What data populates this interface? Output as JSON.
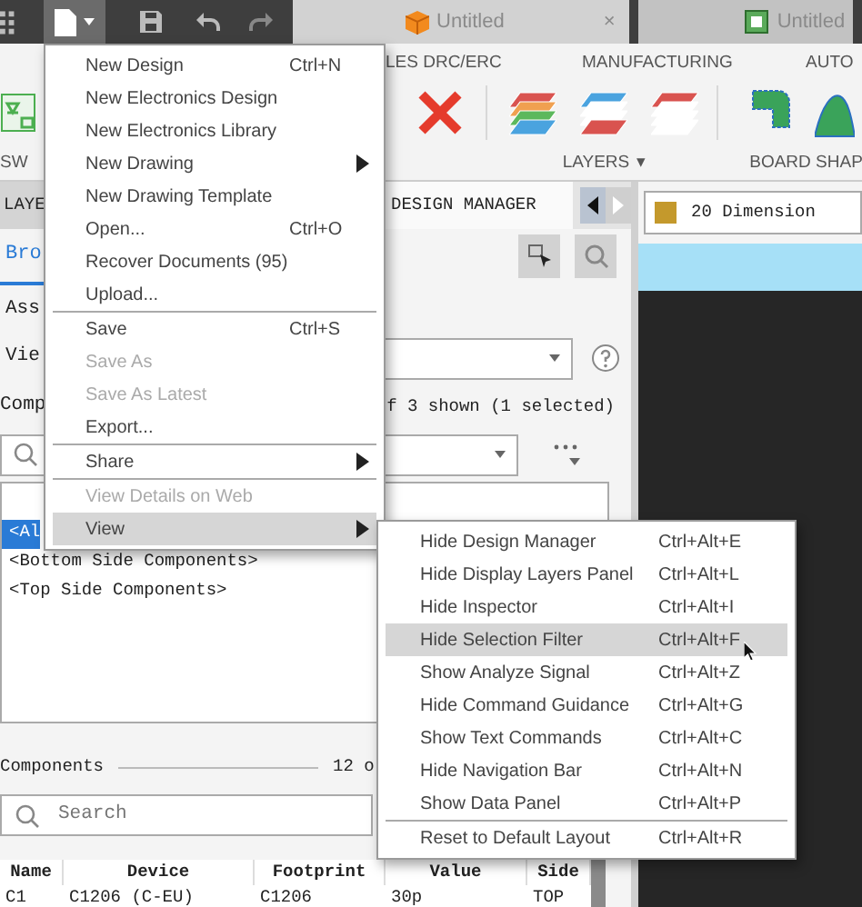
{
  "document_tabs": [
    {
      "label": "Untitled",
      "selected": true,
      "close": "×"
    },
    {
      "label": "Untitled",
      "selected": false
    }
  ],
  "ribbon": {
    "tabs": [
      {
        "label": "LES DRC/ERC"
      },
      {
        "label": "MANUFACTURING"
      },
      {
        "label": "AUTO"
      }
    ],
    "groups": [
      {
        "label": "SW"
      },
      {
        "label": "LAYERS",
        "caret": "▾"
      },
      {
        "label": "BOARD SHAP"
      }
    ]
  },
  "left_panel": {
    "tabs": [
      {
        "label": "LAYE",
        "selected": false
      },
      {
        "label": "DESIGN MANAGER",
        "selected": true
      }
    ],
    "subtabs": [
      {
        "label": "Bro",
        "selected": true
      }
    ],
    "rows": [
      {
        "label": "Ass"
      },
      {
        "label": "Vie"
      }
    ],
    "components_filter": {
      "label": "Comp",
      "summary": "f 3 shown (1 selected)"
    },
    "filter_list": [
      {
        "label": "<Al",
        "selected": true
      },
      {
        "label": "<Bottom Side Components>",
        "selected": false
      },
      {
        "label": "<Top Side Components>",
        "selected": false
      }
    ],
    "components": {
      "label": "Components",
      "count": "12 o",
      "search_placeholder": "Search"
    },
    "table": {
      "columns": [
        "Name",
        "Device",
        "Footprint",
        "Value",
        "Side"
      ],
      "rows": [
        [
          "C1",
          "C1206 (C-EU)",
          "C1206",
          "30p",
          "TOP"
        ]
      ]
    }
  },
  "layer_select": {
    "label": "20 Dimension",
    "color": "#c4992c"
  },
  "file_menu": {
    "items": [
      {
        "kind": "item",
        "label": "New Design",
        "shortcut": "Ctrl+N",
        "disabled": false,
        "submenu": false,
        "selected": false
      },
      {
        "kind": "item",
        "label": "New Electronics Design",
        "disabled": false,
        "submenu": false,
        "selected": false
      },
      {
        "kind": "item",
        "label": "New Electronics Library",
        "disabled": false,
        "submenu": false,
        "selected": false
      },
      {
        "kind": "item",
        "label": "New Drawing",
        "disabled": false,
        "submenu": true,
        "selected": false
      },
      {
        "kind": "item",
        "label": "New Drawing Template",
        "disabled": false,
        "submenu": false,
        "selected": false
      },
      {
        "kind": "item",
        "label": "Open...",
        "shortcut": "Ctrl+O",
        "disabled": false,
        "submenu": false,
        "selected": false
      },
      {
        "kind": "item",
        "label": "Recover Documents (95)",
        "disabled": false,
        "submenu": false,
        "selected": false
      },
      {
        "kind": "item",
        "label": "Upload...",
        "disabled": false,
        "submenu": false,
        "selected": false
      },
      {
        "kind": "separator"
      },
      {
        "kind": "item",
        "label": "Save",
        "shortcut": "Ctrl+S",
        "disabled": false,
        "submenu": false,
        "selected": false
      },
      {
        "kind": "item",
        "label": "Save As",
        "disabled": true,
        "submenu": false,
        "selected": false
      },
      {
        "kind": "item",
        "label": "Save As Latest",
        "disabled": true,
        "submenu": false,
        "selected": false
      },
      {
        "kind": "item",
        "label": "Export...",
        "disabled": false,
        "submenu": false,
        "selected": false
      },
      {
        "kind": "separator"
      },
      {
        "kind": "item",
        "label": "Share",
        "disabled": false,
        "submenu": true,
        "selected": false
      },
      {
        "kind": "separator"
      },
      {
        "kind": "item",
        "label": "View Details on Web",
        "disabled": true,
        "submenu": false,
        "selected": false
      },
      {
        "kind": "item",
        "label": "View",
        "disabled": false,
        "submenu": true,
        "selected": true
      }
    ]
  },
  "view_submenu": {
    "items": [
      {
        "kind": "item",
        "label": "Hide Design Manager",
        "shortcut": "Ctrl+Alt+E",
        "selected": false
      },
      {
        "kind": "item",
        "label": "Hide Display Layers Panel",
        "shortcut": "Ctrl+Alt+L",
        "selected": false
      },
      {
        "kind": "item",
        "label": "Hide Inspector",
        "shortcut": "Ctrl+Alt+I",
        "selected": false
      },
      {
        "kind": "item",
        "label": "Hide Selection Filter",
        "shortcut": "Ctrl+Alt+F",
        "selected": true
      },
      {
        "kind": "item",
        "label": "Show Analyze Signal",
        "shortcut": "Ctrl+Alt+Z",
        "selected": false
      },
      {
        "kind": "item",
        "label": "Hide Command Guidance",
        "shortcut": "Ctrl+Alt+G",
        "selected": false
      },
      {
        "kind": "item",
        "label": "Show Text Commands",
        "shortcut": "Ctrl+Alt+C",
        "selected": false
      },
      {
        "kind": "item",
        "label": "Hide Navigation Bar",
        "shortcut": "Ctrl+Alt+N",
        "selected": false
      },
      {
        "kind": "item",
        "label": "Show Data Panel",
        "shortcut": "Ctrl+Alt+P",
        "selected": false
      },
      {
        "kind": "separator"
      },
      {
        "kind": "item",
        "label": "Reset to Default Layout",
        "shortcut": "Ctrl+Alt+R",
        "selected": false
      }
    ]
  }
}
